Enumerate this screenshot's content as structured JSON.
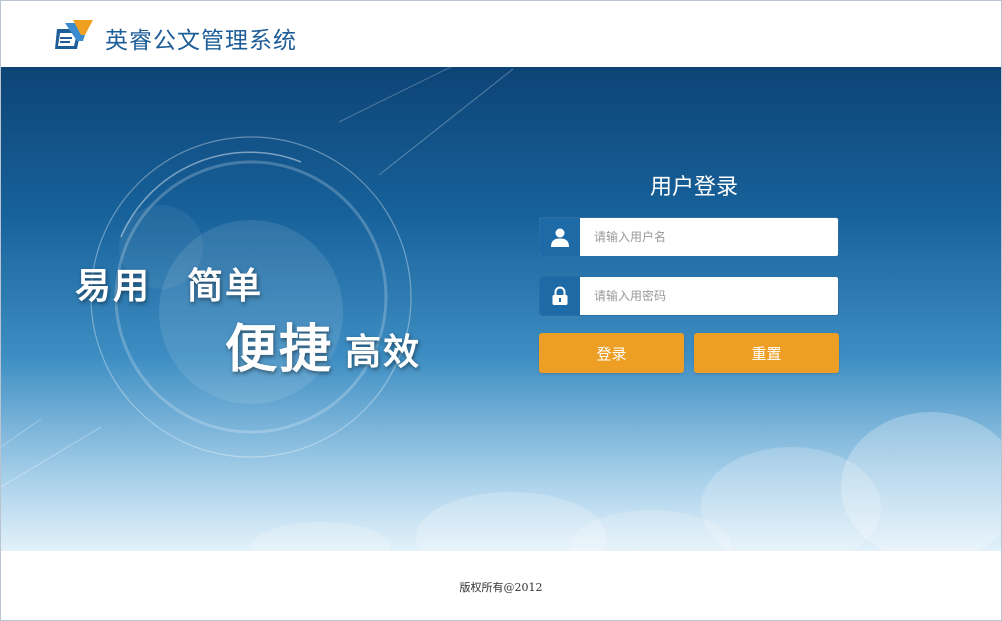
{
  "header": {
    "app_title": "英睿公文管理系统",
    "logo_icon": "doc-logo-icon"
  },
  "hero": {
    "slogan_1": "易用",
    "slogan_2": "简单",
    "slogan_3": "便捷",
    "slogan_4": "高效"
  },
  "login": {
    "title": "用户登录",
    "username_placeholder": "请输入用户名",
    "username_value": "",
    "password_placeholder": "请输入用密码",
    "password_value": "",
    "login_label": "登录",
    "reset_label": "重置",
    "user_icon": "user-icon",
    "lock_icon": "lock-icon"
  },
  "footer": {
    "copyright": "版权所有@2012"
  },
  "colors": {
    "brand_blue": "#1d5d98",
    "icon_box": "#1d6aa6",
    "button_orange": "#ec9f24",
    "hero_top": "#0d4476",
    "hero_bottom": "#e3f1fa"
  }
}
